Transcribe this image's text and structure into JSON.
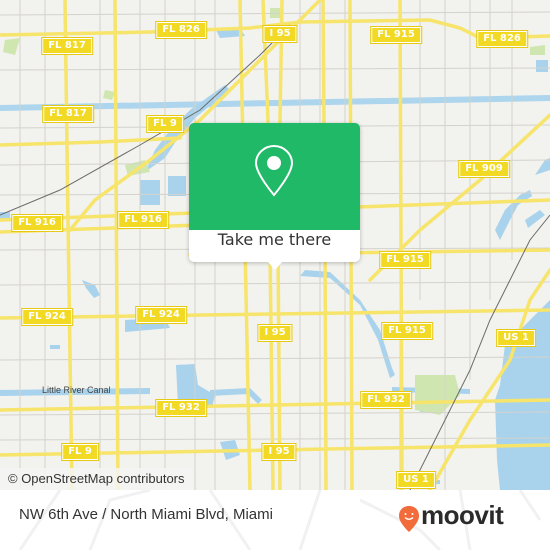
{
  "map": {
    "attribution": "© OpenStreetMap contributors",
    "colors": {
      "land": "#f2f2ee",
      "road_major": "#f7e46a",
      "road_minor": "#d4d2cc",
      "water": "#a9d3ec",
      "park": "#cfe6b0",
      "rail": "#6b6b6b"
    },
    "shields": [
      {
        "label": "FL 817",
        "id": "fl817-a"
      },
      {
        "label": "FL 826",
        "id": "fl826-a"
      },
      {
        "label": "I 95",
        "id": "i95-a"
      },
      {
        "label": "FL 915",
        "id": "fl915-a"
      },
      {
        "label": "FL 826",
        "id": "fl826-b"
      },
      {
        "label": "FL 817",
        "id": "fl817-b"
      },
      {
        "label": "FL 9",
        "id": "fl9-a"
      },
      {
        "label": "FL 909",
        "id": "fl909"
      },
      {
        "label": "FL 916",
        "id": "fl916-a"
      },
      {
        "label": "FL 916",
        "id": "fl916-b"
      },
      {
        "label": "FL 915",
        "id": "fl915-b"
      },
      {
        "label": "FL 924",
        "id": "fl924-a"
      },
      {
        "label": "FL 924",
        "id": "fl924-b"
      },
      {
        "label": "I 95",
        "id": "i95-b"
      },
      {
        "label": "FL 915",
        "id": "fl915-c"
      },
      {
        "label": "US 1",
        "id": "us1-a"
      },
      {
        "label": "FL 932",
        "id": "fl932-a"
      },
      {
        "label": "FL 932",
        "id": "fl932-b"
      },
      {
        "label": "FL 9",
        "id": "fl9-b"
      },
      {
        "label": "I 95",
        "id": "i95-c"
      },
      {
        "label": "US 1",
        "id": "us1-b"
      }
    ],
    "labels": {
      "canal": "Little River Canal"
    }
  },
  "popup": {
    "icon": "map-pin-icon",
    "cta_label": "Take me there"
  },
  "footer": {
    "stop_name": "NW 6th Ave / North Miami Blvd, Miami",
    "brand": "moovit",
    "brand_color": "#f26b3a"
  }
}
